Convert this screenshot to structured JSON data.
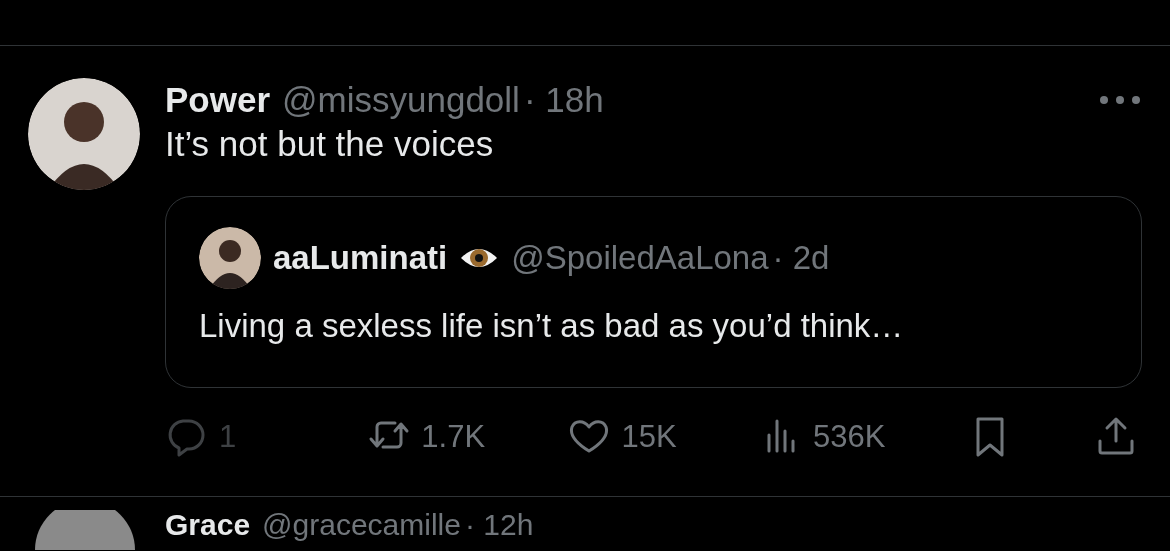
{
  "tweet": {
    "name": "Power",
    "handle": "@missyungdoll",
    "time": "· 18h",
    "text": "It’s not but the voices",
    "quote": {
      "name": "aaLuminati",
      "handle": "@SpoiledAaLona",
      "time": "· 2d",
      "text": "Living a sexless life isn’t as bad as you’d think…"
    },
    "actions": [
      {
        "kind": "reply",
        "count": "1",
        "disabled": true
      },
      {
        "kind": "repost",
        "count": "1.7K",
        "disabled": false
      },
      {
        "kind": "like",
        "count": "15K",
        "disabled": false
      },
      {
        "kind": "views",
        "count": "536K",
        "disabled": false
      },
      {
        "kind": "bookmark",
        "disabled": false
      },
      {
        "kind": "share",
        "disabled": false
      }
    ]
  },
  "next_tweet": {
    "name": "Grace",
    "handle": "@gracecamille",
    "time": "· 12h"
  }
}
